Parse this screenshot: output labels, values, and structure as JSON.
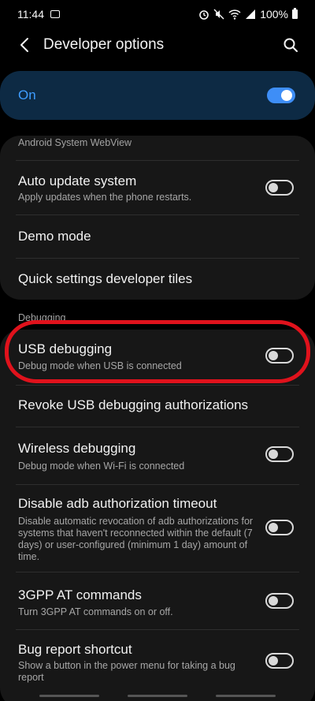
{
  "status_bar": {
    "time": "11:44",
    "battery": "100%"
  },
  "app_bar": {
    "title": "Developer options"
  },
  "master": {
    "label": "On",
    "enabled": true
  },
  "top_card": {
    "truncated_label": "Android System WebView",
    "items": [
      {
        "title": "Auto update system",
        "subtitle": "Apply updates when the phone restarts.",
        "toggle": false
      },
      {
        "title": "Demo mode"
      },
      {
        "title": "Quick settings developer tiles"
      }
    ]
  },
  "debugging": {
    "section_label": "Debugging",
    "items": [
      {
        "title": "USB debugging",
        "subtitle": "Debug mode when USB is connected",
        "toggle": false
      },
      {
        "title": "Revoke USB debugging authorizations"
      },
      {
        "title": "Wireless debugging",
        "subtitle": "Debug mode when Wi-Fi is connected",
        "toggle": false
      },
      {
        "title": "Disable adb authorization timeout",
        "subtitle": "Disable automatic revocation of adb authorizations for systems that haven't reconnected within the default (7 days) or user-configured (minimum 1 day) amount of time.",
        "toggle": false
      },
      {
        "title": "3GPP AT commands",
        "subtitle": "Turn 3GPP AT commands on or off.",
        "toggle": false
      },
      {
        "title": "Bug report shortcut",
        "subtitle": "Show a button in the power menu for taking a bug report",
        "toggle": false
      }
    ]
  },
  "colors": {
    "accent": "#3e8ef7",
    "master_bg": "#0d2a44",
    "highlight": "#e0121c"
  }
}
